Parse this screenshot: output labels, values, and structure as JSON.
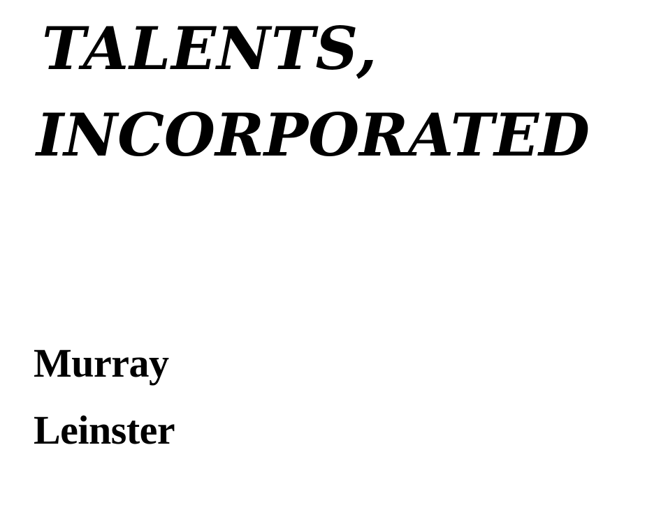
{
  "title": {
    "line1": "TALENTS,",
    "line2": "INCORPORATED"
  },
  "author": {
    "first_name": "Murray",
    "last_name": "Leinster"
  }
}
